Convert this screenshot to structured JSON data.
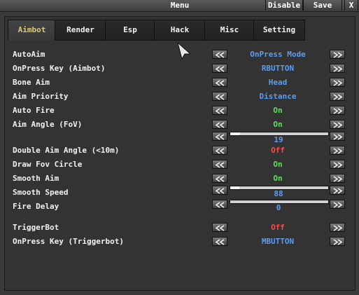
{
  "window": {
    "title": "Menu",
    "disable_label": "Disable",
    "save_label": "Save",
    "close_label": "X"
  },
  "tabs": [
    {
      "label": "Aimbot",
      "active": true
    },
    {
      "label": "Render",
      "active": false
    },
    {
      "label": "Esp",
      "active": false
    },
    {
      "label": "Hack",
      "active": false
    },
    {
      "label": "Misc",
      "active": false
    },
    {
      "label": "Setting",
      "active": false
    }
  ],
  "settings": [
    {
      "label": "AutoAim",
      "value": "OnPress Mode",
      "color": "#5c9cf0"
    },
    {
      "label": "OnPress Key (Aimbot)",
      "value": "RBUTTON",
      "color": "#5c9cf0"
    },
    {
      "label": "Bone Aim",
      "value": "Head",
      "color": "#5c9cf0"
    },
    {
      "label": "Aim Priority",
      "value": "Distance",
      "color": "#5c9cf0"
    },
    {
      "label": "Auto Fire",
      "value": "On",
      "color": "#5ee05e"
    },
    {
      "label": "Aim Angle (FoV)",
      "value": "On",
      "color": "#5ee05e",
      "slider_value": "19",
      "slider_fraction": 0.1
    },
    {
      "label": "Double Aim Angle (<10m)",
      "value": "Off",
      "color": "#f05050"
    },
    {
      "label": "Draw Fov Circle",
      "value": "On",
      "color": "#5ee05e"
    },
    {
      "label": "Smooth Aim",
      "value": "On",
      "color": "#5ee05e"
    },
    {
      "label": "Smooth Speed",
      "slider_value": "88",
      "slider_fraction": 0.09
    },
    {
      "label": "Fire Delay",
      "slider_value": "0",
      "slider_fraction": 0.0
    },
    {
      "label": "TriggerBot",
      "value": "Off",
      "color": "#f05050"
    },
    {
      "label": "OnPress Key (Triggerbot)",
      "value": "MBUTTON",
      "color": "#5c9cf0"
    }
  ]
}
